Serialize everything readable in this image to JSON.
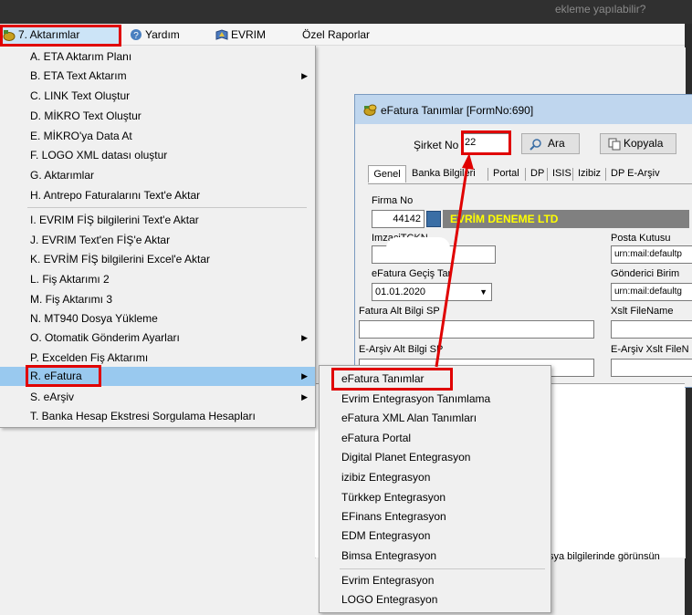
{
  "background_hint": "ekleme yapılabilir?",
  "menubar": {
    "items": [
      {
        "label": "7.  Aktarımlar"
      },
      {
        "label": "Yardım"
      },
      {
        "label": "EVRIM"
      },
      {
        "label": "Özel Raporlar"
      }
    ]
  },
  "dropdown": {
    "items": [
      {
        "label": "A.  ETA Aktarım Planı"
      },
      {
        "label": "B.  ETA Text Aktarım"
      },
      {
        "label": "C.  LINK Text Oluştur"
      },
      {
        "label": "D.  MİKRO Text Oluştur"
      },
      {
        "label": "E.  MİKRO'ya  Data  At"
      },
      {
        "label": "F.  LOGO XML datası oluştur"
      },
      {
        "label": "G.  Aktarımlar"
      },
      {
        "label": "H.  Antrepo Faturalarını Text'e Aktar"
      },
      {
        "label": "I.   EVRIM FİŞ bilgilerini Text'e Aktar"
      },
      {
        "label": "J.   EVRIM Text'en FİŞ'e Aktar"
      },
      {
        "label": "K.   EVRİM FİŞ bilgilerini Excel'e Aktar"
      },
      {
        "label": "L.  Fiş Aktarımı 2"
      },
      {
        "label": "M.  Fiş Aktarımı 3"
      },
      {
        "label": "N.  MT940 Dosya Yükleme"
      },
      {
        "label": "O. Otomatik Gönderim Ayarları"
      },
      {
        "label": "P.  Excelden Fiş Aktarımı"
      },
      {
        "label": "R. eFatura"
      },
      {
        "label": "S.  eArşiv"
      },
      {
        "label": "T. Banka Hesap Ekstresi Sorgulama Hesapları"
      }
    ]
  },
  "submenu": {
    "items": [
      {
        "label": "eFatura Tanımlar"
      },
      {
        "label": "Evrim Entegrasyon Tanımlama"
      },
      {
        "label": "eFatura XML Alan Tanımları"
      },
      {
        "label": "eFatura Portal"
      },
      {
        "label": "Digital Planet Entegrasyon"
      },
      {
        "label": "izibiz Entegrasyon"
      },
      {
        "label": "Türkkep Entegrasyon"
      },
      {
        "label": "EFinans Entegrasyon"
      },
      {
        "label": "EDM Entegrasyon"
      },
      {
        "label": "Bimsa Entegrasyon"
      },
      {
        "label": "Evrim Entegrasyon"
      },
      {
        "label": "LOGO Entegrasyon"
      }
    ]
  },
  "form": {
    "title": "eFatura Tanımlar [FormNo:690]",
    "sirket_no_label": "Şirket No",
    "sirket_no_value": "22",
    "ara_label": "Ara",
    "kopyala_label": "Kopyala",
    "tabs": [
      {
        "label": "Genel"
      },
      {
        "label": "Banka Bilgileri"
      },
      {
        "label": "Portal"
      },
      {
        "label": "DP"
      },
      {
        "label": "ISIS"
      },
      {
        "label": "Izibiz"
      },
      {
        "label": "DP E-Arşiv"
      }
    ],
    "firma_no_label": "Firma No",
    "firma_no_value": "44142",
    "firma_name": "EVRİM DENEME LTD",
    "imzaci_label": "ImzaciTCKN",
    "posta_kutusu_label": "Posta Kutusu",
    "posta_kutusu_value": "urn:mail:defaultp",
    "gecis_label": "eFatura Geçiş Tar",
    "gecis_value": "01.01.2020",
    "gonderici_label": "Gönderici Birim",
    "gonderici_value": "urn:mail:defaultg",
    "fatura_alt_label": "Fatura Alt Bilgi SP",
    "xslt_label": "Xslt FileName",
    "earsiv_alt_label": "E-Arşiv Alt Bilgi SP",
    "earsiv_xslt_label": "E-Arşiv Xslt FileN"
  },
  "bottom_text": "sya bilgilerinde görünsün",
  "colors": {
    "annotation_red": "#e00000",
    "menu_highlight": "#99c9ef",
    "firma_name_bg": "#808080",
    "firma_name_fg": "#ffff00"
  }
}
